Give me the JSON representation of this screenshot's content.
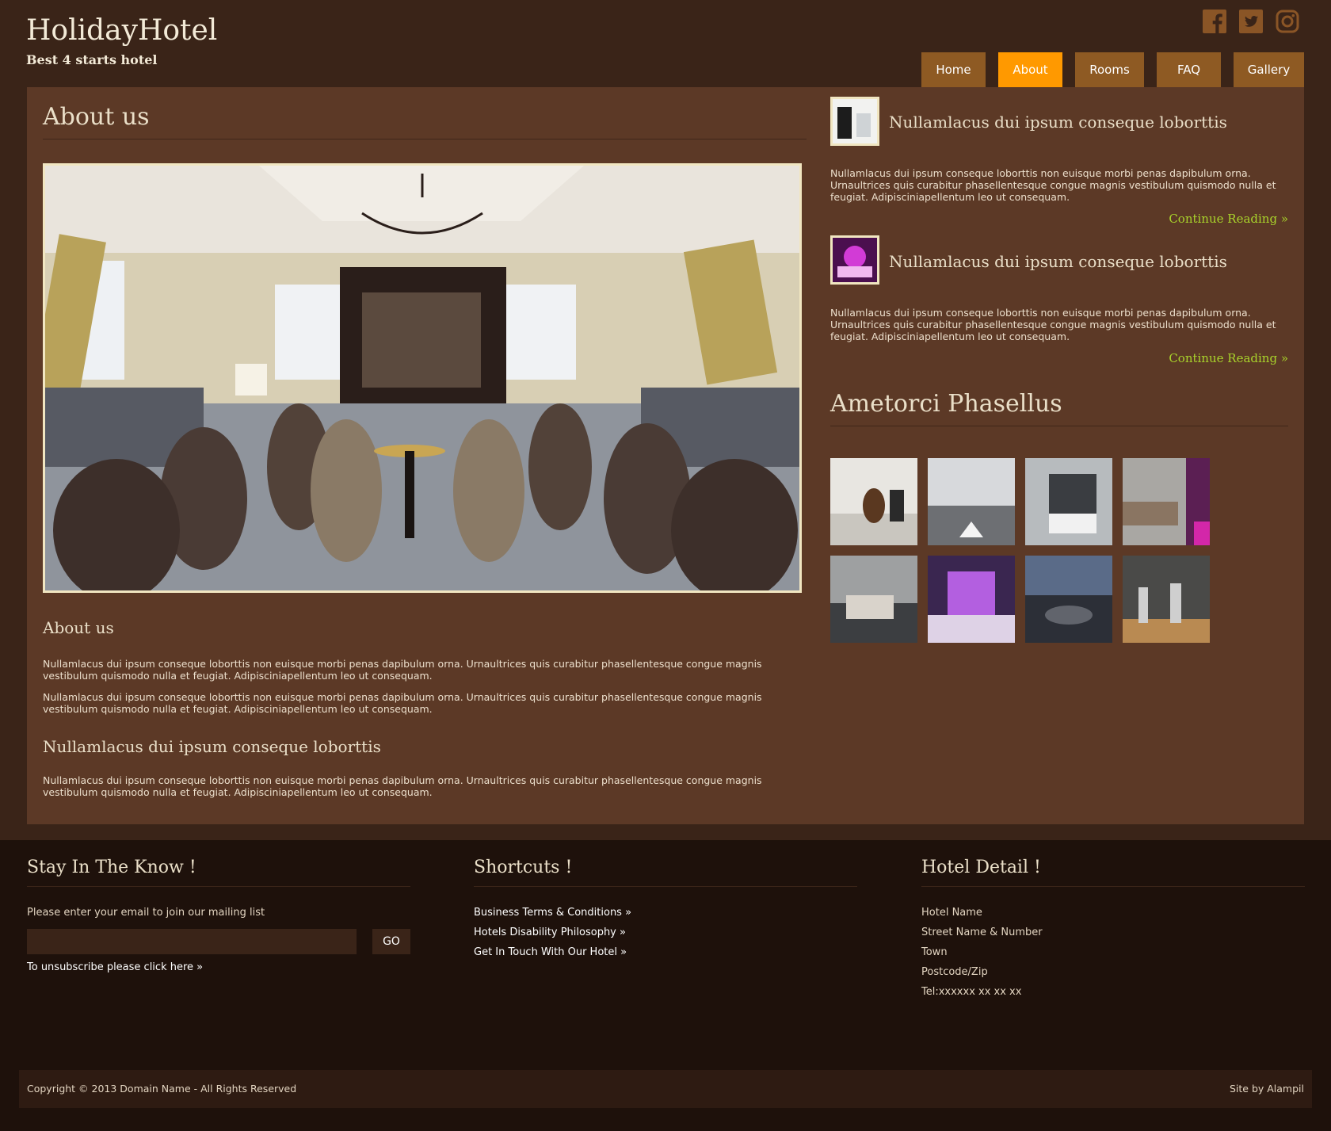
{
  "brand": {
    "title": "HolidayHotel",
    "subtitle": "Best 4 starts hotel"
  },
  "social": [
    {
      "icon": "facebook-icon"
    },
    {
      "icon": "twitter-icon"
    },
    {
      "icon": "instagram-icon"
    }
  ],
  "nav": {
    "items": [
      "Home",
      "About",
      "Rooms",
      "FAQ",
      "Gallery"
    ],
    "active": "About"
  },
  "main": {
    "title": "About us",
    "about_heading": "About us",
    "paragraph_1": "Nullamlacus dui ipsum conseque loborttis non euisque morbi penas dapibulum orna. Urnaultrices quis curabitur phasellentesque congue magnis vestibulum quismodo nulla et feugiat. Adipisciniapellentum leo ut consequam.",
    "paragraph_2": "Nullamlacus dui ipsum conseque loborttis non euisque morbi penas dapibulum orna. Urnaultrices quis curabitur phasellentesque congue magnis vestibulum quismodo nulla et feugiat. Adipisciniapellentum leo ut consequam.",
    "subheading": "Nullamlacus dui ipsum conseque loborttis",
    "paragraph_3": "Nullamlacus dui ipsum conseque loborttis non euisque morbi penas dapibulum orna. Urnaultrices quis curabitur phasellentesque congue magnis vestibulum quismodo nulla et feugiat. Adipisciniapellentum leo ut consequam."
  },
  "sidebar": {
    "posts": [
      {
        "title": "Nullamlacus dui ipsum conseque loborttis",
        "text": "Nullamlacus dui ipsum conseque loborttis non euisque morbi penas dapibulum orna. Urnaultrices quis curabitur phasellentesque congue magnis vestibulum quismodo nulla et feugiat. Adipisciniapellentum leo ut consequam.",
        "link": "Continue Reading »"
      },
      {
        "title": "Nullamlacus dui ipsum conseque loborttis",
        "text": "Nullamlacus dui ipsum conseque loborttis non euisque morbi penas dapibulum orna. Urnaultrices quis curabitur phasellentesque congue magnis vestibulum quismodo nulla et feugiat. Adipisciniapellentum leo ut consequam.",
        "link": "Continue Reading »"
      }
    ],
    "gallery_title": "Ametorci Phasellus"
  },
  "footer": {
    "newsletter": {
      "title": "Stay In The Know !",
      "label": "Please enter your email to join our mailing list",
      "input_value": "",
      "button": "GO",
      "unsubscribe": "To unsubscribe please click here »"
    },
    "shortcuts": {
      "title": "Shortcuts !",
      "links": [
        "Business Terms & Conditions »",
        "Hotels Disability Philosophy »",
        "Get In Touch With Our Hotel »"
      ]
    },
    "hotel": {
      "title": "Hotel Detail !",
      "lines": [
        "Hotel Name",
        "Street Name & Number",
        "Town",
        "Postcode/Zip",
        "Tel:xxxxxx xx xx xx"
      ]
    },
    "copyright": "Copyright © 2013 Domain Name - All Rights Reserved",
    "credit": "Site by Alampil"
  },
  "colors": {
    "background": "#3a2418",
    "panel": "#5c3926",
    "nav": "#8e5a23",
    "nav_active": "#ff9900",
    "link_green": "#a9d42b",
    "footer": "#1e110b"
  }
}
